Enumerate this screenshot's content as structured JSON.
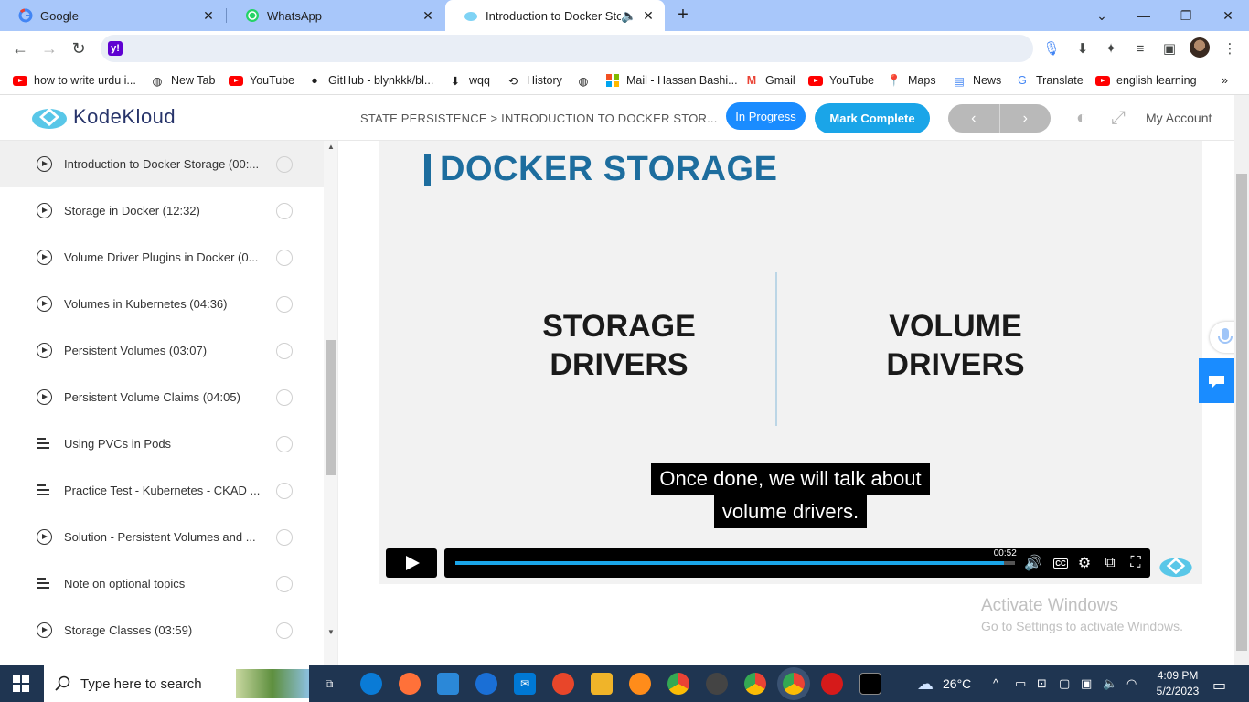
{
  "browser": {
    "tabs": [
      {
        "title": "Google",
        "icon": "google-icon"
      },
      {
        "title": "WhatsApp",
        "icon": "whatsapp-icon"
      },
      {
        "title": "Introduction to Docker Stora",
        "icon": "kodekloud-icon",
        "active": true
      }
    ],
    "address": "",
    "bookmarks": [
      {
        "label": "how to write urdu i...",
        "icon": "youtube-icon"
      },
      {
        "label": "New Tab",
        "icon": "globe-icon"
      },
      {
        "label": "YouTube",
        "icon": "youtube-icon"
      },
      {
        "label": "GitHub - blynkkk/bl...",
        "icon": "github-icon"
      },
      {
        "label": "wqq",
        "icon": "download-icon"
      },
      {
        "label": "History",
        "icon": "history-icon"
      },
      {
        "label": "",
        "icon": "globe-icon"
      },
      {
        "label": "Mail - Hassan Bashi...",
        "icon": "microsoft-icon"
      },
      {
        "label": "Gmail",
        "icon": "gmail-icon"
      },
      {
        "label": "YouTube",
        "icon": "youtube-icon"
      },
      {
        "label": "Maps",
        "icon": "maps-icon"
      },
      {
        "label": "News",
        "icon": "news-icon"
      },
      {
        "label": "Translate",
        "icon": "translate-icon"
      },
      {
        "label": "english learning",
        "icon": "youtube-icon"
      }
    ]
  },
  "header": {
    "brand": "KodeKloud",
    "breadcrumb": "STATE PERSISTENCE > INTRODUCTION TO DOCKER STOR...",
    "status_label": "In Progress",
    "complete_label": "Mark Complete",
    "prev": "‹",
    "next": "›",
    "account_label": "My Account",
    "accent": "#1aa5e8"
  },
  "sidebar": {
    "lessons": [
      {
        "title": "Introduction to Docker Storage (00:...",
        "type": "video",
        "current": true
      },
      {
        "title": "Storage in Docker (12:32)",
        "type": "video"
      },
      {
        "title": "Volume Driver Plugins in Docker (0...",
        "type": "video"
      },
      {
        "title": "Volumes in Kubernetes (04:36)",
        "type": "video"
      },
      {
        "title": "Persistent Volumes (03:07)",
        "type": "video"
      },
      {
        "title": "Persistent Volume Claims (04:05)",
        "type": "video"
      },
      {
        "title": "Using PVCs in Pods",
        "type": "text"
      },
      {
        "title": "Practice Test - Kubernetes - CKAD ...",
        "type": "text"
      },
      {
        "title": "Solution - Persistent Volumes and ...",
        "type": "video"
      },
      {
        "title": "Note on optional topics",
        "type": "text"
      },
      {
        "title": "Storage Classes (03:59)",
        "type": "video"
      }
    ]
  },
  "video": {
    "slide_title": "DOCKER STORAGE",
    "left_col": [
      "STORAGE",
      "DRIVERS"
    ],
    "right_col": [
      "VOLUME",
      "DRIVERS"
    ],
    "subtitle_lines": [
      "Once done, we will talk about",
      "volume drivers."
    ],
    "time": "00:52",
    "progress": 0.98
  },
  "watermark": {
    "line1": "Activate Windows",
    "line2": "Go to Settings to activate Windows."
  },
  "taskbar": {
    "search_placeholder": "Type here to search",
    "weather": "26°C",
    "time": "4:09 PM",
    "date": "5/2/2023"
  }
}
